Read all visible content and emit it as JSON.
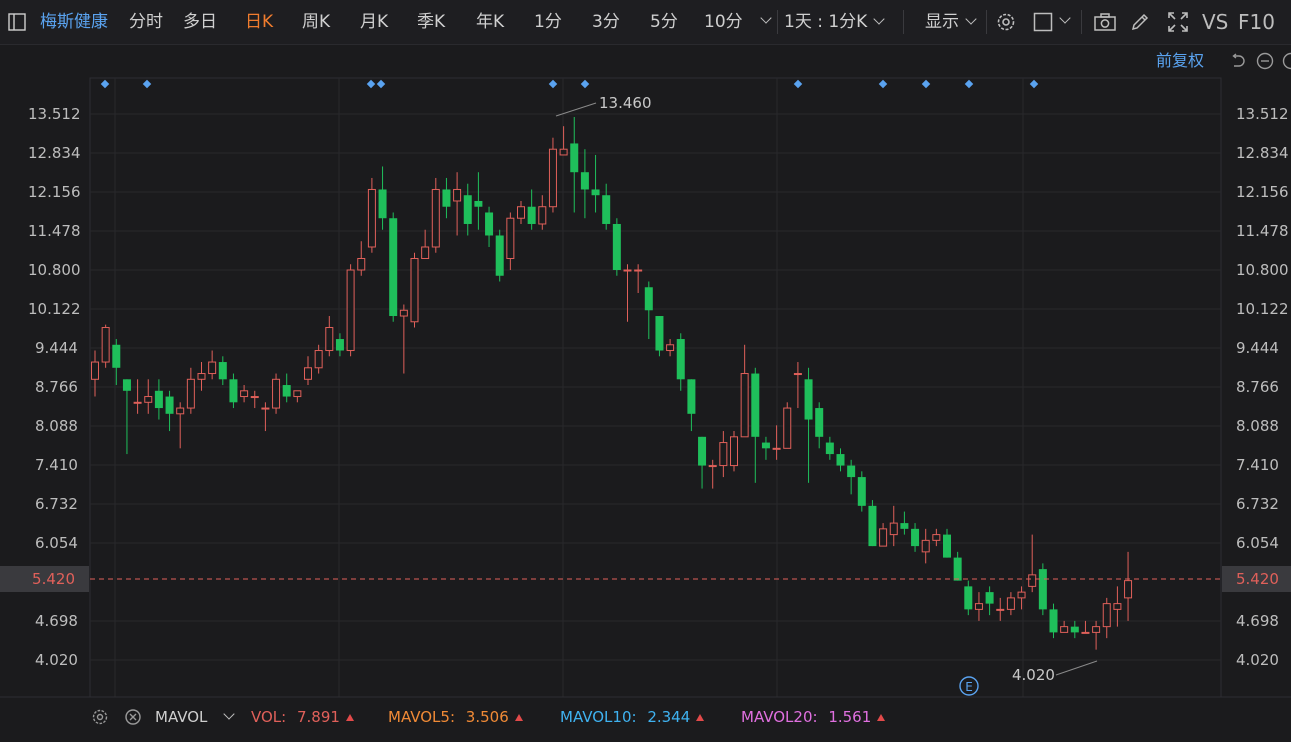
{
  "toolbar": {
    "stock_name": "梅斯健康",
    "periods": [
      "分时",
      "多日",
      "日K",
      "周K",
      "月K",
      "季K",
      "年K",
      "1分",
      "3分",
      "5分",
      "10分"
    ],
    "active_period": "日K",
    "interval": "1天 : 1分K",
    "display_label": "显示",
    "vs_label": "VS",
    "f10_label": "F10"
  },
  "adjust_label": "前复权",
  "colors": {
    "up": "#e0605a",
    "down": "#1fbf5b",
    "accent": "#5aa3f0",
    "active": "#f07c2e",
    "bg": "#1b1b1d"
  },
  "chart_data": {
    "type": "candlestick",
    "y_ticks": [
      "13.512",
      "12.834",
      "12.156",
      "11.478",
      "10.800",
      "10.122",
      "9.444",
      "8.766",
      "8.088",
      "7.410",
      "6.732",
      "6.054",
      "4.698",
      "4.020"
    ],
    "current_price": "5.420",
    "high_annotation": "13.460",
    "low_annotation": "4.020",
    "event_marker": "E",
    "candles": [
      [
        8.9,
        9.2,
        8.6,
        9.4
      ],
      [
        9.2,
        9.8,
        9.1,
        9.85
      ],
      [
        9.5,
        9.1,
        8.8,
        9.6
      ],
      [
        8.9,
        8.7,
        7.6,
        8.9
      ],
      [
        8.5,
        8.5,
        8.3,
        8.9
      ],
      [
        8.5,
        8.6,
        8.3,
        8.9
      ],
      [
        8.7,
        8.4,
        8.2,
        8.9
      ],
      [
        8.6,
        8.3,
        8.0,
        8.7
      ],
      [
        8.3,
        8.4,
        7.7,
        8.5
      ],
      [
        8.4,
        8.9,
        8.3,
        9.1
      ],
      [
        8.9,
        9.0,
        8.7,
        9.2
      ],
      [
        9.0,
        9.2,
        8.9,
        9.4
      ],
      [
        9.2,
        8.9,
        8.8,
        9.3
      ],
      [
        8.9,
        8.5,
        8.4,
        9.0
      ],
      [
        8.6,
        8.7,
        8.5,
        8.8
      ],
      [
        8.6,
        8.6,
        8.4,
        8.7
      ],
      [
        8.4,
        8.4,
        8.0,
        8.5
      ],
      [
        8.4,
        8.9,
        8.3,
        9.0
      ],
      [
        8.8,
        8.6,
        8.5,
        9.0
      ],
      [
        8.6,
        8.7,
        8.5,
        8.7
      ],
      [
        8.9,
        9.1,
        8.8,
        9.3
      ],
      [
        9.1,
        9.4,
        9.0,
        9.5
      ],
      [
        9.4,
        9.8,
        9.3,
        10.0
      ],
      [
        9.6,
        9.4,
        9.3,
        9.7
      ],
      [
        9.4,
        10.8,
        9.3,
        10.9
      ],
      [
        10.8,
        11.0,
        10.7,
        11.3
      ],
      [
        11.2,
        12.2,
        11.1,
        12.4
      ],
      [
        12.2,
        11.7,
        11.5,
        12.6
      ],
      [
        11.7,
        10.0,
        9.9,
        11.8
      ],
      [
        10.0,
        10.1,
        9.0,
        10.2
      ],
      [
        9.9,
        11.0,
        9.8,
        11.1
      ],
      [
        11.0,
        11.2,
        11.0,
        11.5
      ],
      [
        11.2,
        12.2,
        11.1,
        12.4
      ],
      [
        12.2,
        11.9,
        11.7,
        12.4
      ],
      [
        12.0,
        12.2,
        11.4,
        12.5
      ],
      [
        12.1,
        11.6,
        11.4,
        12.3
      ],
      [
        12.0,
        11.9,
        11.5,
        12.5
      ],
      [
        11.8,
        11.4,
        11.2,
        11.9
      ],
      [
        11.4,
        10.7,
        10.6,
        11.5
      ],
      [
        11.0,
        11.7,
        10.8,
        11.8
      ],
      [
        11.7,
        11.9,
        11.6,
        12.0
      ],
      [
        11.9,
        11.6,
        11.5,
        12.2
      ],
      [
        11.6,
        11.9,
        11.5,
        12.1
      ],
      [
        11.9,
        12.9,
        11.8,
        13.1
      ],
      [
        12.8,
        12.9,
        12.8,
        13.3
      ],
      [
        13.0,
        12.5,
        11.8,
        13.46
      ],
      [
        12.5,
        12.2,
        11.7,
        12.9
      ],
      [
        12.2,
        12.1,
        11.8,
        12.8
      ],
      [
        12.1,
        11.6,
        11.5,
        12.3
      ],
      [
        11.6,
        10.8,
        10.7,
        11.7
      ],
      [
        10.8,
        10.8,
        9.9,
        10.9
      ],
      [
        10.8,
        10.8,
        10.4,
        10.9
      ],
      [
        10.5,
        10.1,
        9.6,
        10.6
      ],
      [
        10.0,
        9.4,
        9.3,
        10.0
      ],
      [
        9.4,
        9.5,
        9.3,
        9.6
      ],
      [
        9.6,
        8.9,
        8.7,
        9.7
      ],
      [
        8.9,
        8.3,
        8.0,
        8.9
      ],
      [
        7.9,
        7.4,
        7.0,
        7.9
      ],
      [
        7.4,
        7.4,
        7.0,
        7.5
      ],
      [
        7.4,
        7.8,
        7.2,
        8.0
      ],
      [
        7.4,
        7.9,
        7.3,
        8.0
      ],
      [
        7.9,
        9.0,
        7.9,
        9.5
      ],
      [
        9.0,
        7.9,
        7.1,
        9.1
      ],
      [
        7.8,
        7.7,
        7.5,
        7.9
      ],
      [
        7.7,
        7.7,
        7.5,
        8.1
      ],
      [
        7.7,
        8.4,
        7.7,
        8.5
      ],
      [
        9.0,
        9.0,
        8.4,
        9.2
      ],
      [
        8.9,
        8.2,
        7.1,
        9.1
      ],
      [
        8.4,
        7.9,
        7.7,
        8.5
      ],
      [
        7.8,
        7.6,
        7.5,
        7.9
      ],
      [
        7.6,
        7.4,
        7.3,
        7.7
      ],
      [
        7.4,
        7.2,
        6.9,
        7.5
      ],
      [
        7.2,
        6.7,
        6.6,
        7.3
      ],
      [
        6.7,
        6.0,
        6.0,
        6.8
      ],
      [
        6.0,
        6.3,
        6.0,
        6.4
      ],
      [
        6.2,
        6.4,
        6.0,
        6.7
      ],
      [
        6.4,
        6.3,
        6.2,
        6.6
      ],
      [
        6.3,
        6.0,
        5.9,
        6.4
      ],
      [
        5.9,
        6.1,
        5.7,
        6.3
      ],
      [
        6.1,
        6.2,
        6.0,
        6.3
      ],
      [
        6.2,
        5.8,
        5.8,
        6.3
      ],
      [
        5.8,
        5.4,
        5.4,
        5.9
      ],
      [
        5.3,
        4.9,
        4.8,
        5.4
      ],
      [
        4.9,
        5.0,
        4.7,
        5.2
      ],
      [
        5.2,
        5.0,
        4.8,
        5.3
      ],
      [
        4.9,
        4.9,
        4.7,
        5.1
      ],
      [
        4.9,
        5.1,
        4.8,
        5.2
      ],
      [
        5.1,
        5.2,
        4.9,
        5.3
      ],
      [
        5.3,
        5.5,
        5.2,
        6.2
      ],
      [
        5.6,
        4.9,
        4.8,
        5.7
      ],
      [
        4.9,
        4.5,
        4.4,
        5.0
      ],
      [
        4.5,
        4.6,
        4.5,
        4.7
      ],
      [
        4.6,
        4.5,
        4.4,
        4.7
      ],
      [
        4.5,
        4.5,
        4.5,
        4.7
      ],
      [
        4.5,
        4.6,
        4.2,
        4.7
      ],
      [
        4.6,
        5.0,
        4.4,
        5.1
      ],
      [
        4.9,
        5.0,
        4.6,
        5.3
      ],
      [
        5.1,
        5.4,
        4.7,
        5.9
      ]
    ],
    "volume_panel": {
      "indicator": "MAVOL",
      "vol_label": "VOL:",
      "vol_value": "7.891",
      "mavol5_label": "MAVOL5:",
      "mavol5_value": "3.506",
      "mavol10_label": "MAVOL10:",
      "mavol10_value": "2.344",
      "mavol20_label": "MAVOL20:",
      "mavol20_value": "1.561",
      "colors": {
        "vol": "#e0605a",
        "mavol5": "#f08a36",
        "mavol10": "#3fb2f0",
        "mavol20": "#e070e0"
      }
    }
  }
}
